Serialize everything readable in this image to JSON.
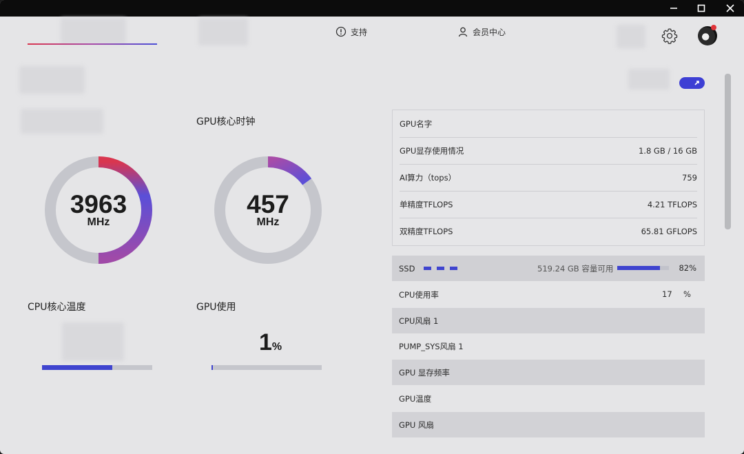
{
  "window_controls": [
    "minimize",
    "maximize",
    "close"
  ],
  "header": {
    "support_label": "支持",
    "member_label": "会员中心"
  },
  "colors": {
    "accent": "#3f44cf",
    "gauge_start": "#d9364f",
    "gauge_end": "#4b4fd6",
    "track": "#c5c6cc"
  },
  "gauges": {
    "cpu_clock": {
      "value": "3963",
      "unit": "MHz",
      "arc_start_fraction": 0.0,
      "arc_end_fraction": 0.5
    },
    "gpu_clock": {
      "title": "GPU核心时钟",
      "value": "457",
      "unit": "MHz",
      "arc_start_fraction": 0.0,
      "arc_end_fraction": 0.15
    }
  },
  "cpu_temp": {
    "title": "CPU核心温度",
    "bar_fraction": 0.64
  },
  "gpu_usage": {
    "title": "GPU使用",
    "value": "1",
    "unit": "%",
    "bar_fraction": 0.01
  },
  "gpu_info": [
    {
      "label": "GPU名字",
      "value": ""
    },
    {
      "label": "GPU显存使用情况",
      "value": "1.8 GB / 16 GB"
    },
    {
      "label": "AI算力（tops）",
      "value": "759"
    },
    {
      "label": "单精度TFLOPS",
      "value": "4.21 TFLOPS"
    },
    {
      "label": "双精度TFLOPS",
      "value": "65.81 GFLOPS"
    }
  ],
  "ssd": {
    "label": "SSD",
    "available": "519.24 GB 容量可用",
    "percent": "82%",
    "fraction": 0.82
  },
  "metrics": [
    {
      "label": "CPU使用率",
      "value": "17",
      "unit": "%"
    },
    {
      "label": "CPU风扇 1"
    },
    {
      "label": "PUMP_SYS风扇 1"
    },
    {
      "label": "GPU 显存频率"
    },
    {
      "label": "GPU温度"
    },
    {
      "label": "GPU 风扇"
    }
  ]
}
